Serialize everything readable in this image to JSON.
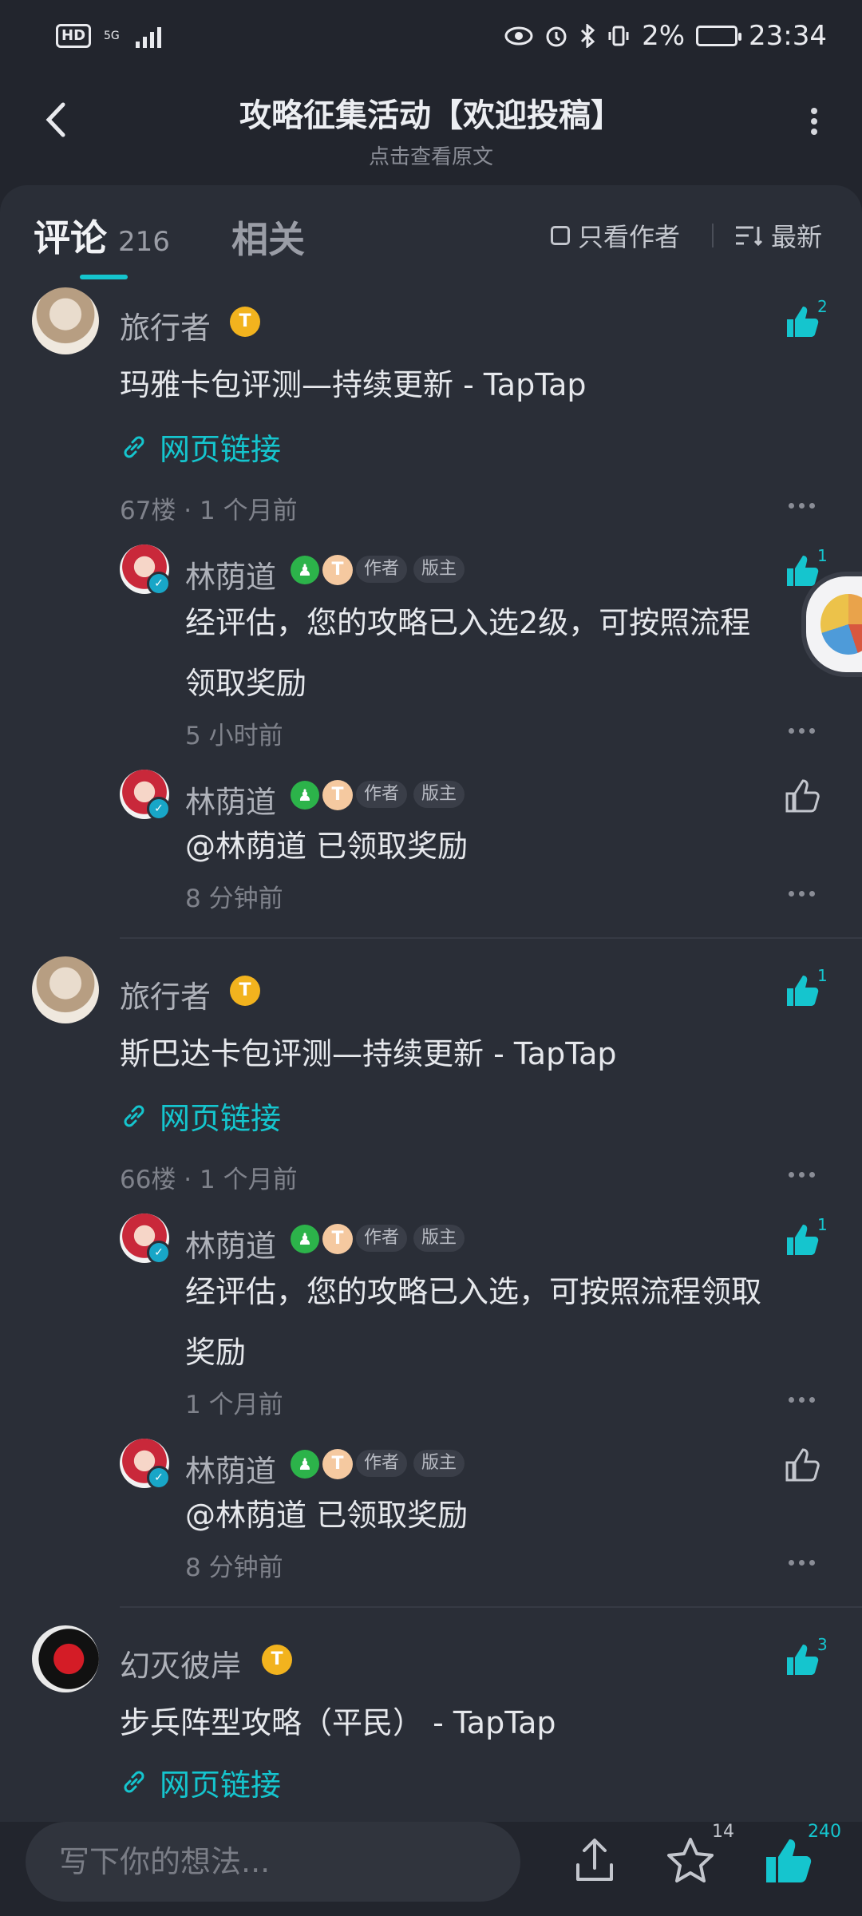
{
  "status_bar": {
    "hd": "HD",
    "network": "5G",
    "battery": "2%",
    "time": "23:34"
  },
  "header": {
    "title": "攻略征集活动【欢迎投稿】",
    "subtitle": "点击查看原文"
  },
  "tabs": {
    "comment_label": "评论",
    "comment_count": "216",
    "related_label": "相关",
    "only_author": "只看作者",
    "sort": "最新"
  },
  "comments": [
    {
      "name": "旅行者",
      "text": "玛雅卡包评测—持续更新 - TapTap",
      "link": "网页链接",
      "meta": "67楼 · 1 个月前",
      "likes": "2",
      "replies": [
        {
          "name": "林荫道",
          "tag_author": "作者",
          "tag_mod": "版主",
          "text_line1": "经评估，您的攻略已入选2级，可按照流程",
          "text_line2": "领取奖励",
          "meta": "5 小时前",
          "likes": "1"
        },
        {
          "name": "林荫道",
          "tag_author": "作者",
          "tag_mod": "版主",
          "text_line1": "@林荫道  已领取奖励",
          "meta": "8 分钟前",
          "likes": ""
        }
      ]
    },
    {
      "name": "旅行者",
      "text": "斯巴达卡包评测—持续更新 - TapTap",
      "link": "网页链接",
      "meta": "66楼 · 1 个月前",
      "likes": "1",
      "replies": [
        {
          "name": "林荫道",
          "tag_author": "作者",
          "tag_mod": "版主",
          "text_line1": "经评估，您的攻略已入选，可按照流程领取",
          "text_line2": "奖励",
          "meta": "1 个月前",
          "likes": "1"
        },
        {
          "name": "林荫道",
          "tag_author": "作者",
          "tag_mod": "版主",
          "text_line1": "@林荫道  已领取奖励",
          "meta": "8 分钟前",
          "likes": ""
        }
      ]
    },
    {
      "name": "幻灭彼岸",
      "text": "步兵阵型攻略（平民） - TapTap",
      "link": "网页链接",
      "likes": "3"
    }
  ],
  "bottom": {
    "placeholder": "写下你的想法...",
    "star_count": "14",
    "like_count": "240"
  },
  "colors": {
    "accent": "#15c5ce",
    "background": "#22252d",
    "panel": "#2a2e37"
  }
}
